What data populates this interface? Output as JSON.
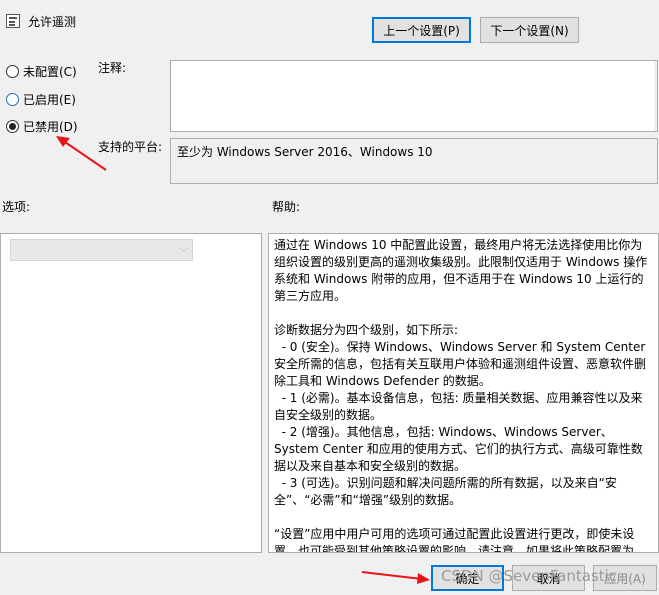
{
  "window": {
    "title": "允许遥测"
  },
  "nav": {
    "prev": "上一个设置(P)",
    "next": "下一个设置(N)"
  },
  "radios": [
    {
      "label": "未配置(C)",
      "checked": false
    },
    {
      "label": "已启用(E)",
      "checked": false
    },
    {
      "label": "已禁用(D)",
      "checked": true
    }
  ],
  "comment": {
    "label": "注释:",
    "value": ""
  },
  "platform": {
    "label": "支持的平台:",
    "value": "至少为 Windows Server 2016、Windows 10"
  },
  "options": {
    "label": "选项:"
  },
  "help": {
    "label": "帮助:",
    "text": "通过在 Windows 10 中配置此设置，最终用户将无法选择使用比你为组织设置的级别更高的遥测收集级别。此限制仅适用于 Windows 操作系统和 Windows 附带的应用，但不适用于在 Windows 10 上运行的第三方应用。\n\n诊断数据分为四个级别，如下所示:\n  - 0 (安全)。保持 Windows、Windows Server 和 System Center 安全所需的信息，包括有关互联用户体验和遥测组件设置、恶意软件删除工具和 Windows Defender 的数据。\n  - 1 (必需)。基本设备信息，包括: 质量相关数据、应用兼容性以及来自安全级别的数据。\n  - 2 (增强)。其他信息，包括: Windows、Windows Server、System Center 和应用的使用方式、它们的执行方式、高级可靠性数据以及来自基本和安全级别的数据。\n  - 3 (可选)。识别问题和解决问题所需的所有数据，以及来自“安全”、“必需”和“增强”级别的数据。\n\n“设置”应用中用户可用的选项可通过配置此设置进行更改，即使未设置，也可能受到其他策略设置的影响。请注意，如果将此策略配置为"
  },
  "footer": {
    "ok": "确定",
    "cancel": "取消",
    "apply": "应用(A)"
  },
  "watermark": "CSDN @SevenFantastic",
  "colors": {
    "accent": "#0078d7",
    "annotation_arrow": "#e8141b"
  }
}
